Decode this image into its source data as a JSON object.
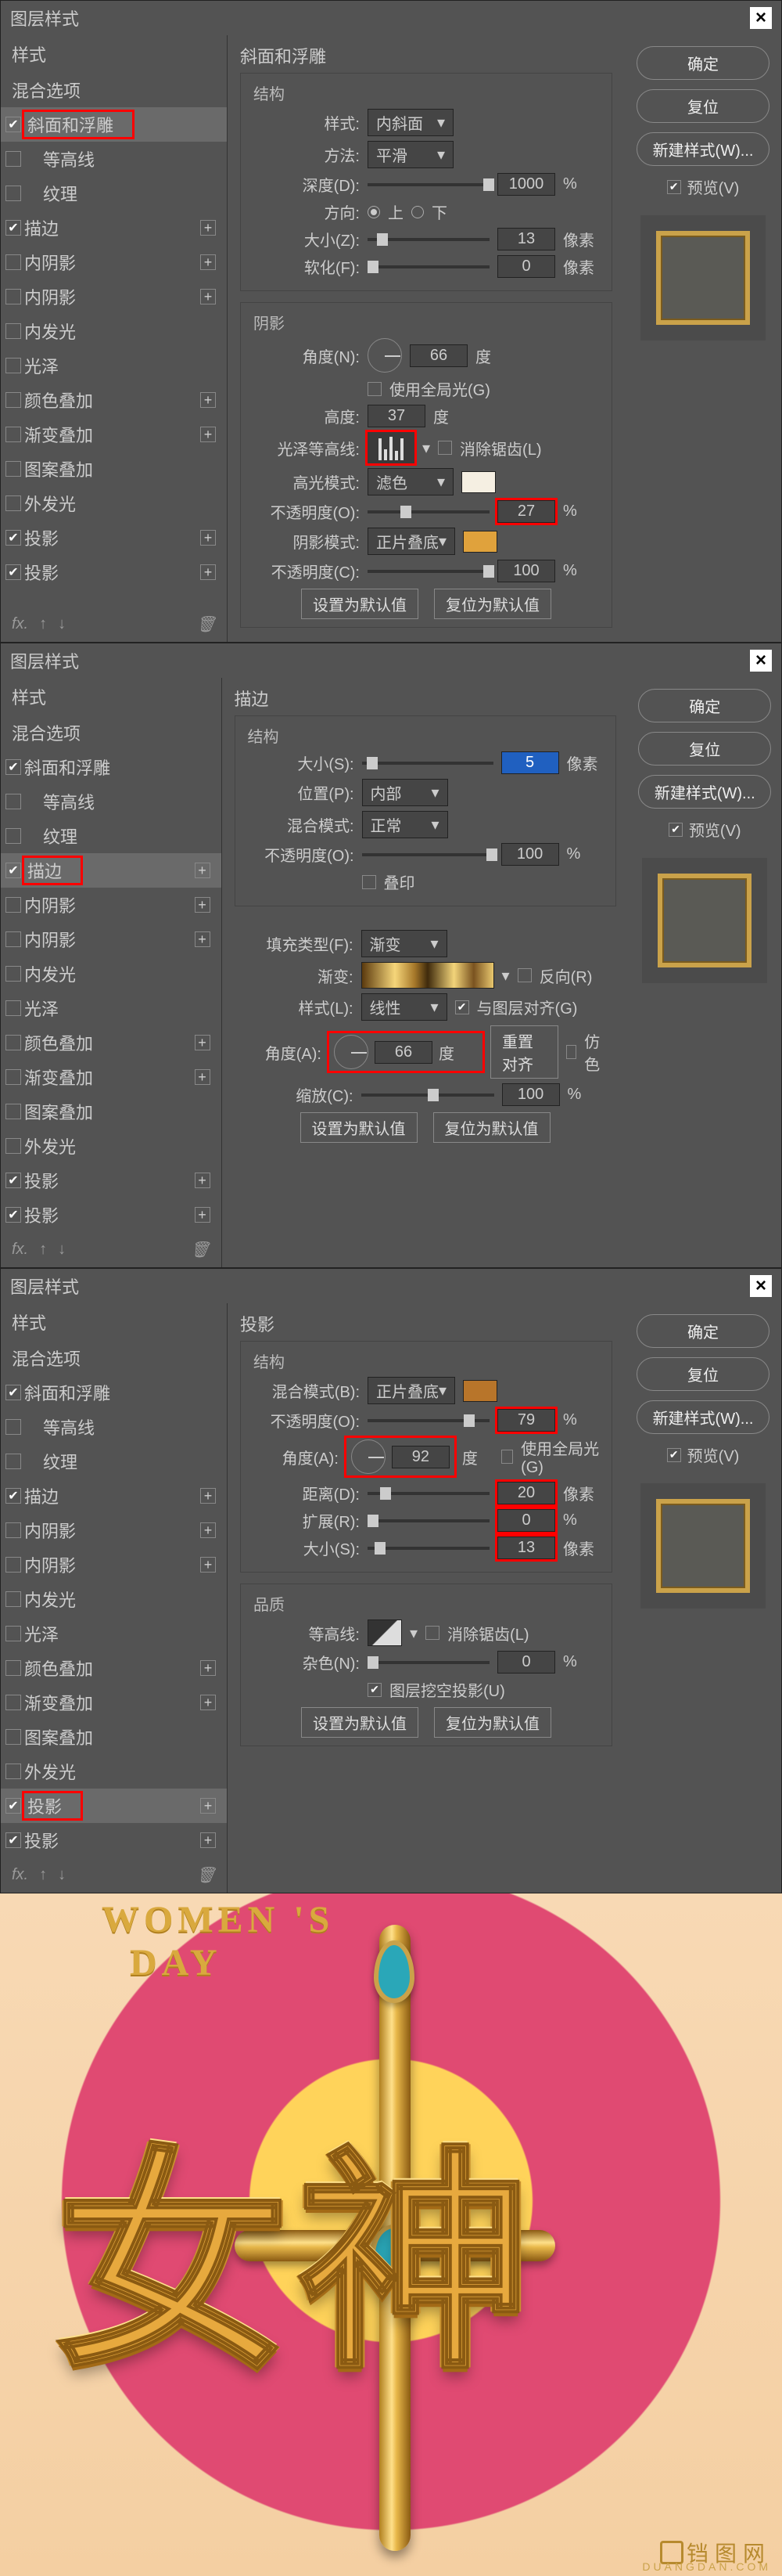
{
  "dialogs": [
    {
      "title": "图层样式",
      "styles_header": "样式",
      "blend_options": "混合选项",
      "items": [
        {
          "label": "斜面和浮雕",
          "checked": true,
          "active": true,
          "red": true
        },
        {
          "label": "等高线",
          "checked": false,
          "indent": true
        },
        {
          "label": "纹理",
          "checked": false,
          "indent": true
        },
        {
          "label": "描边",
          "checked": true,
          "plus": true
        },
        {
          "label": "内阴影",
          "checked": false,
          "plus": true
        },
        {
          "label": "内阴影",
          "checked": false,
          "plus": true
        },
        {
          "label": "内发光",
          "checked": false
        },
        {
          "label": "光泽",
          "checked": false
        },
        {
          "label": "颜色叠加",
          "checked": false,
          "plus": true
        },
        {
          "label": "渐变叠加",
          "checked": false,
          "plus": true
        },
        {
          "label": "图案叠加",
          "checked": false
        },
        {
          "label": "外发光",
          "checked": false
        },
        {
          "label": "投影",
          "checked": true,
          "plus": true
        },
        {
          "label": "投影",
          "checked": true,
          "plus": true
        }
      ],
      "section": "斜面和浮雕",
      "struct": {
        "label": "结构",
        "style_l": "样式:",
        "style_v": "内斜面",
        "method_l": "方法:",
        "method_v": "平滑",
        "depth_l": "深度(D):",
        "depth_v": "1000",
        "depth_u": "%",
        "dir_l": "方向:",
        "up": "上",
        "down": "下",
        "size_l": "大小(Z):",
        "size_v": "13",
        "size_u": "像素",
        "soft_l": "软化(F):",
        "soft_v": "0",
        "soft_u": "像素"
      },
      "shadow": {
        "label": "阴影",
        "angle_l": "角度(N):",
        "angle_v": "66",
        "angle_u": "度",
        "global": "使用全局光(G)",
        "alt_l": "高度:",
        "alt_v": "37",
        "alt_u": "度",
        "gloss_l": "光泽等高线:",
        "aa": "消除锯齿(L)",
        "hmode_l": "高光模式:",
        "hmode_v": "滤色",
        "hopac_l": "不透明度(O):",
        "hopac_v": "27",
        "hopac_u": "%",
        "smode_l": "阴影模式:",
        "smode_v": "正片叠底",
        "sopac_l": "不透明度(C):",
        "sopac_v": "100",
        "sopac_u": "%"
      },
      "btns": {
        "default": "设置为默认值",
        "reset": "复位为默认值"
      },
      "right": {
        "ok": "确定",
        "cancel": "复位",
        "new": "新建样式(W)...",
        "preview": "预览(V)"
      }
    },
    {
      "title": "图层样式",
      "styles_header": "样式",
      "blend_options": "混合选项",
      "items": [
        {
          "label": "斜面和浮雕",
          "checked": true
        },
        {
          "label": "等高线",
          "checked": false,
          "indent": true
        },
        {
          "label": "纹理",
          "checked": false,
          "indent": true
        },
        {
          "label": "描边",
          "checked": true,
          "active": true,
          "red": true,
          "plus": true
        },
        {
          "label": "内阴影",
          "checked": false,
          "plus": true
        },
        {
          "label": "内阴影",
          "checked": false,
          "plus": true
        },
        {
          "label": "内发光",
          "checked": false
        },
        {
          "label": "光泽",
          "checked": false
        },
        {
          "label": "颜色叠加",
          "checked": false,
          "plus": true
        },
        {
          "label": "渐变叠加",
          "checked": false,
          "plus": true
        },
        {
          "label": "图案叠加",
          "checked": false
        },
        {
          "label": "外发光",
          "checked": false
        },
        {
          "label": "投影",
          "checked": true,
          "plus": true
        },
        {
          "label": "投影",
          "checked": true,
          "plus": true
        }
      ],
      "section": "描边",
      "struct": {
        "label": "结构",
        "size_l": "大小(S):",
        "size_v": "5",
        "size_u": "像素",
        "pos_l": "位置(P):",
        "pos_v": "内部",
        "blend_l": "混合模式:",
        "blend_v": "正常",
        "opac_l": "不透明度(O):",
        "opac_v": "100",
        "opac_u": "%",
        "overprint": "叠印"
      },
      "fill": {
        "type_l": "填充类型(F):",
        "type_v": "渐变",
        "grad_l": "渐变:",
        "reverse": "反向(R)",
        "style_l": "样式(L):",
        "style_v": "线性",
        "align": "与图层对齐(G)",
        "angle_l": "角度(A):",
        "angle_v": "66",
        "angle_u": "度",
        "realign": "重置对齐",
        "dither": "仿色",
        "scale_l": "缩放(C):",
        "scale_v": "100",
        "scale_u": "%"
      },
      "btns": {
        "default": "设置为默认值",
        "reset": "复位为默认值"
      },
      "right": {
        "ok": "确定",
        "cancel": "复位",
        "new": "新建样式(W)...",
        "preview": "预览(V)"
      }
    },
    {
      "title": "图层样式",
      "styles_header": "样式",
      "blend_options": "混合选项",
      "items": [
        {
          "label": "斜面和浮雕",
          "checked": true
        },
        {
          "label": "等高线",
          "checked": false,
          "indent": true
        },
        {
          "label": "纹理",
          "checked": false,
          "indent": true
        },
        {
          "label": "描边",
          "checked": true,
          "plus": true
        },
        {
          "label": "内阴影",
          "checked": false,
          "plus": true
        },
        {
          "label": "内阴影",
          "checked": false,
          "plus": true
        },
        {
          "label": "内发光",
          "checked": false
        },
        {
          "label": "光泽",
          "checked": false
        },
        {
          "label": "颜色叠加",
          "checked": false,
          "plus": true
        },
        {
          "label": "渐变叠加",
          "checked": false,
          "plus": true
        },
        {
          "label": "图案叠加",
          "checked": false
        },
        {
          "label": "外发光",
          "checked": false
        },
        {
          "label": "投影",
          "checked": true,
          "active": true,
          "red": true,
          "plus": true
        },
        {
          "label": "投影",
          "checked": true,
          "plus": true
        }
      ],
      "section": "投影",
      "struct": {
        "label": "结构",
        "blend_l": "混合模式(B):",
        "blend_v": "正片叠底",
        "opac_l": "不透明度(O):",
        "opac_v": "79",
        "opac_u": "%",
        "angle_l": "角度(A):",
        "angle_v": "92",
        "angle_u": "度",
        "global": "使用全局光(G)",
        "dist_l": "距离(D):",
        "dist_v": "20",
        "dist_u": "像素",
        "spread_l": "扩展(R):",
        "spread_v": "0",
        "spread_u": "%",
        "size_l": "大小(S):",
        "size_v": "13",
        "size_u": "像素"
      },
      "quality": {
        "label": "品质",
        "contour_l": "等高线:",
        "aa": "消除锯齿(L)",
        "noise_l": "杂色(N):",
        "noise_v": "0",
        "noise_u": "%",
        "knockout": "图层挖空投影(U)"
      },
      "btns": {
        "default": "设置为默认值",
        "reset": "复位为默认值"
      },
      "right": {
        "ok": "确定",
        "cancel": "复位",
        "new": "新建样式(W)...",
        "preview": "预览(V)"
      }
    }
  ],
  "artwork": {
    "top_text": "WOMEN'S\nDAY",
    "brand": "铛图网",
    "brand_sub": "DUANGDAN.COM",
    "char1": "女",
    "char2": "神"
  }
}
